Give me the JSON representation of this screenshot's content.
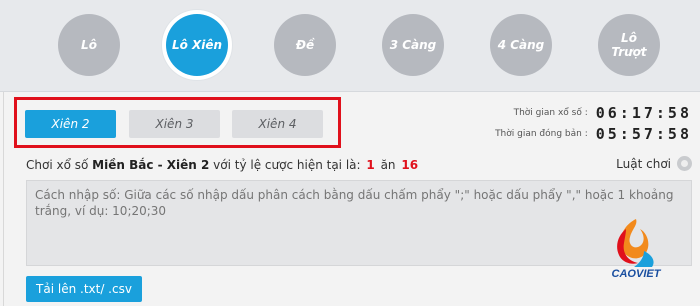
{
  "categories": [
    {
      "label": "Lô",
      "active": false
    },
    {
      "label": "Lô Xiên",
      "active": true
    },
    {
      "label": "Đề",
      "active": false
    },
    {
      "label": "3 Càng",
      "active": false
    },
    {
      "label": "4 Càng",
      "active": false
    },
    {
      "label": "Lô\nTrượt",
      "active": false
    }
  ],
  "subtabs": [
    {
      "label": "Xiên 2",
      "active": true
    },
    {
      "label": "Xiên 3",
      "active": false
    },
    {
      "label": "Xiên 4",
      "active": false
    }
  ],
  "timers": {
    "draw_label": "Thời gian xổ số :",
    "draw_value": "06:17:58",
    "close_label": "Thời gian đóng bản :",
    "close_value": "05:57:58"
  },
  "info": {
    "prefix": "Chơi xổ số",
    "game": "Miền Bắc - Xiên 2",
    "middle": "với tỷ lệ cược hiện tại là:",
    "rate_a": "1",
    "rate_word": "ăn",
    "rate_b": "16"
  },
  "rules_link": "Luật chơi",
  "input": {
    "placeholder": "Cách nhập số: Giữa các số nhập dấu phân cách bằng dấu chấm phẩy \";\" hoặc dấu phẩy \",\" hoặc 1 khoảng trắng, ví dụ: 10;20;30"
  },
  "upload_button": "Tải lên .txt/ .csv",
  "logo_text": "CAOVIET",
  "colors": {
    "accent": "#1aa0dc",
    "highlight": "#e0101b",
    "inactive_circle": "#b6b9bf"
  }
}
